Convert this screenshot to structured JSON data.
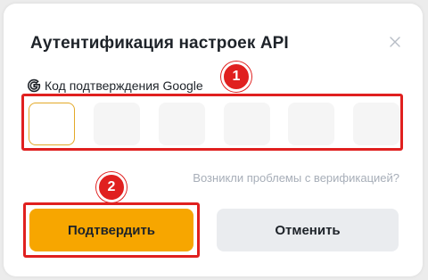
{
  "dialog": {
    "title": "Аутентификация настроек API",
    "close_icon": "close-icon"
  },
  "code_field": {
    "icon": "google-icon",
    "label": "Код подтверждения Google",
    "digits": [
      "",
      "",
      "",
      "",
      "",
      ""
    ],
    "active_index": 0
  },
  "help_link": "Возникли проблемы с верификацией?",
  "buttons": {
    "confirm": "Подтвердить",
    "cancel": "Отменить"
  },
  "annotations": {
    "marker_1": "1",
    "marker_2": "2"
  },
  "colors": {
    "accent": "#f7a600",
    "annotation": "#e0201f",
    "cancel_bg": "#eaecef",
    "muted_text": "#a7aeb8"
  }
}
